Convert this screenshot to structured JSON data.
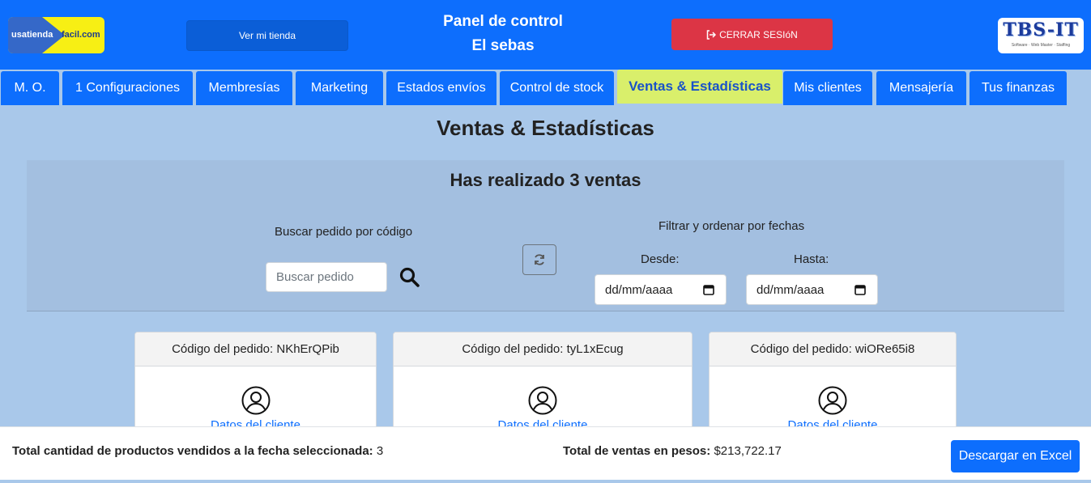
{
  "header": {
    "logo_left_part1": "usatienda",
    "logo_left_part2": "facil.com",
    "store_button": "Ver mi tienda",
    "title_line1": "Panel de control",
    "title_line2": "El sebas",
    "logout_button": "CERRAR SESIóN",
    "logo_right_text": "TBS-IT",
    "logo_right_tagline": "Software · Web Master · Staffing"
  },
  "tabs": [
    {
      "label": "M. O."
    },
    {
      "label": "1 Configuraciones"
    },
    {
      "label": "Membresías"
    },
    {
      "label": "Marketing"
    },
    {
      "label": "Estados envíos"
    },
    {
      "label": "Control de stock"
    },
    {
      "label": "Ventas & Estadísticas",
      "active": true
    },
    {
      "label": "Mis clientes"
    },
    {
      "label": "Mensajería"
    },
    {
      "label": "Tus finanzas"
    }
  ],
  "main": {
    "title": "Ventas & Estadísticas",
    "summary": "Has realizado 3 ventas",
    "search_label": "Buscar pedido por código",
    "search_placeholder": "Buscar pedido",
    "filter_label": "Filtrar y ordenar por fechas",
    "from_label": "Desde:",
    "to_label": "Hasta:",
    "date_placeholder": "dd/mm/aaaa"
  },
  "orders": [
    {
      "code": "Código del pedido: NKhErQPib",
      "client_link": "Datos del cliente"
    },
    {
      "code": "Código del pedido: tyL1xEcug",
      "client_link": "Datos del cliente"
    },
    {
      "code": "Código del pedido: wiORe65i8",
      "client_link": "Datos del cliente"
    }
  ],
  "footer": {
    "qty_label": "Total cantidad de productos vendidos a la fecha seleccionada:",
    "qty_value": "3",
    "sales_label": "Total de ventas en pesos:",
    "sales_value": "$213,722.17",
    "excel_button": "Descargar en Excel"
  },
  "colors": {
    "primary": "#0d6efd",
    "danger": "#dc3545",
    "active_tab": "#d9ef6b",
    "background": "#a9c8ea"
  },
  "icons": {
    "search": "search-icon",
    "refresh": "refresh-icon",
    "logout": "logout-icon",
    "calendar": "calendar-icon",
    "user": "user-circle-icon"
  }
}
